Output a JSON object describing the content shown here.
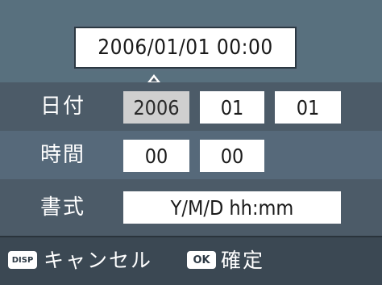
{
  "preview": {
    "datetime": "2006/01/01 00:00"
  },
  "date_row": {
    "label": "日付",
    "year": "2006",
    "month": "01",
    "day": "01"
  },
  "time_row": {
    "label": "時間",
    "hour": "00",
    "minute": "00"
  },
  "format_row": {
    "label": "書式",
    "value": "Y/M/D hh:mm"
  },
  "footer": {
    "disp_badge": "DISP",
    "cancel_label": "キャンセル",
    "ok_badge": "OK",
    "confirm_label": "確定"
  },
  "colors": {
    "background": "#4a5966",
    "field": "#ffffff",
    "selected_field": "#cfcfcf",
    "footer": "#3b4853"
  }
}
